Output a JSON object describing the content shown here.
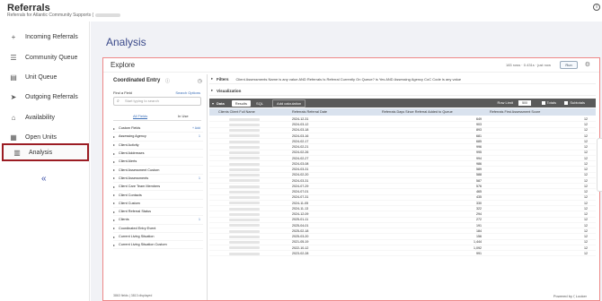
{
  "app": {
    "title": "Referrals",
    "subtitle": "Referrals for Atlantic Community Supports (",
    "help": "i"
  },
  "sidebar": {
    "items": [
      {
        "label": "Incoming Referrals",
        "icon": "incoming-referrals-icon",
        "glyph": "+"
      },
      {
        "label": "Community Queue",
        "icon": "community-queue-icon",
        "glyph": "☰"
      },
      {
        "label": "Unit Queue",
        "icon": "unit-queue-icon",
        "glyph": "▤"
      },
      {
        "label": "Outgoing Referrals",
        "icon": "outgoing-referrals-icon",
        "glyph": "➤"
      },
      {
        "label": "Availability",
        "icon": "availability-icon",
        "glyph": "⌂"
      },
      {
        "label": "Open Units",
        "icon": "open-units-icon",
        "glyph": "▦"
      },
      {
        "label": "Analysis",
        "icon": "analysis-icon",
        "glyph": "▥"
      }
    ],
    "active": "Analysis",
    "collapse_glyph": "«"
  },
  "main": {
    "title": "Analysis",
    "explore": {
      "title": "Explore",
      "meta": "183 rows · 0.431s · just now",
      "run_label": "Run",
      "gear": "⚙",
      "left_panel": {
        "title": "Coordinated Entry",
        "info": "ⓘ",
        "find_label": "Find a Field",
        "search_options": "Search Options",
        "search_placeholder": "Start typing to search",
        "tabs": [
          "All Fields",
          "In Use"
        ],
        "fields": [
          {
            "label": "Custom Fields",
            "extra": "+ Add"
          },
          {
            "label": "Assessing Agency",
            "extra": "1"
          },
          {
            "label": "Client Activity",
            "extra": ""
          },
          {
            "label": "Client Addresses",
            "extra": ""
          },
          {
            "label": "Client Alerts",
            "extra": ""
          },
          {
            "label": "Client Assessment Custom",
            "extra": ""
          },
          {
            "label": "Client Assessments",
            "extra": "1"
          },
          {
            "label": "Client Care Team Members",
            "extra": ""
          },
          {
            "label": "Client Contacts",
            "extra": ""
          },
          {
            "label": "Client Custom",
            "extra": ""
          },
          {
            "label": "Client Referral Status",
            "extra": ""
          },
          {
            "label": "Clients",
            "extra": "1"
          },
          {
            "label": "Coordinated Entry Event",
            "extra": ""
          },
          {
            "label": "Current Living Situation",
            "extra": ""
          },
          {
            "label": "Current Living Situation Custom",
            "extra": ""
          }
        ],
        "footer": "3863 fields | 3813 displayed"
      },
      "filters": {
        "label": "Filters",
        "text": "Client Assessments Name is any value AND Referrals Is Referral Currently On Queue? is Yes AND Assessing Agency CoC Code is any value"
      },
      "visualization": {
        "label": "Visualization"
      },
      "data": {
        "label": "Data",
        "tabs": [
          "Results",
          "SQL"
        ],
        "add_calc": "Add calculation",
        "row_limit_label": "Row Limit",
        "row_limit": "500",
        "totals": "Totals",
        "subtotals": "Subtotals",
        "columns": [
          "Clients Client Full Name",
          "Referrals Referral Date",
          "Referrals Days Since Referral Added to Queue",
          "Referrals First Assessment Score"
        ],
        "rows": [
          [
            "2024-12-31",
            "649",
            "12"
          ],
          [
            "2024-03-12",
            "903",
            "12"
          ],
          [
            "2024-03-18",
            "893",
            "12"
          ],
          [
            "2024-03-16",
            "681",
            "12"
          ],
          [
            "2024-02-17",
            "685",
            "12"
          ],
          [
            "2024-02-21",
            "996",
            "12"
          ],
          [
            "2024-02-26",
            "995",
            "12"
          ],
          [
            "2024-02-27",
            "994",
            "12"
          ],
          [
            "2024-03-08",
            "986",
            "12"
          ],
          [
            "2024-03-31",
            "589",
            "12"
          ],
          [
            "2024-02-20",
            "588",
            "12"
          ],
          [
            "2024-03-31",
            "587",
            "12"
          ],
          [
            "2024-07-29",
            "576",
            "12"
          ],
          [
            "2024-07-01",
            "465",
            "12"
          ],
          [
            "2024-07-31",
            "435",
            "12"
          ],
          [
            "2024-11-05",
            "330",
            "12"
          ],
          [
            "2024-11-13",
            "322",
            "12"
          ],
          [
            "2024-12-09",
            "294",
            "12"
          ],
          [
            "2025-01-11",
            "272",
            "12"
          ],
          [
            "2025-04-01",
            "191",
            "12"
          ],
          [
            "2025-02-18",
            "184",
            "12"
          ],
          [
            "2025-03-20",
            "156",
            "12"
          ],
          [
            "2021-05-19",
            "1,444",
            "12"
          ],
          [
            "2022-10-12",
            "1,092",
            "12"
          ],
          [
            "2023-02-28",
            "991",
            "12"
          ]
        ]
      },
      "powered_by": "Powered by ⟨ Looker"
    }
  }
}
